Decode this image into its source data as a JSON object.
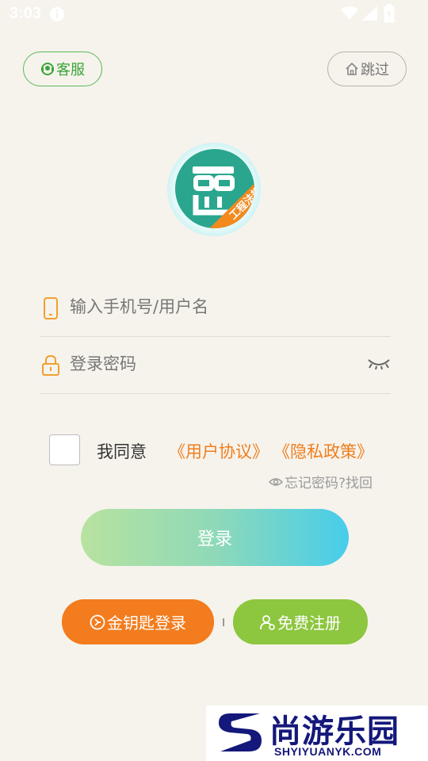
{
  "status_bar": {
    "time": "3:03"
  },
  "header": {
    "service_label": "客服",
    "skip_label": "跳过"
  },
  "logo": {
    "ribbon_text": "工程法规",
    "colors": {
      "circle": "#2aa68e",
      "ribbon": "#f28a1e"
    }
  },
  "form": {
    "phone_placeholder": "输入手机号/用户名",
    "password_placeholder": "登录密码"
  },
  "agreement": {
    "checked": false,
    "label": "我同意",
    "user_agreement": "《用户协议》",
    "privacy_policy": "《隐私政策》"
  },
  "forgot": {
    "label": "忘记密码?找回"
  },
  "actions": {
    "login_label": "登录",
    "key_login_label": "金钥匙登录",
    "register_label": "免费注册"
  },
  "watermark": {
    "cn": "尚游乐园",
    "en": "SHYIYUANYK.COM"
  },
  "colors": {
    "background": "#f6f3ec",
    "accent_orange": "#f27c1e",
    "accent_green": "#8dc63f",
    "service_green": "#3aa53a"
  }
}
